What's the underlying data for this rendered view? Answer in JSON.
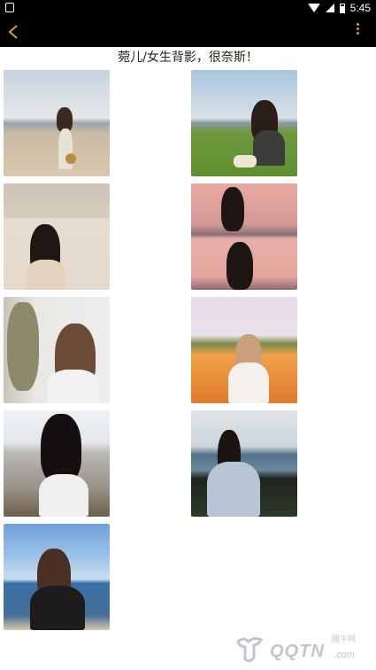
{
  "status_bar": {
    "time": "5:45",
    "icons": [
      "notification-icon",
      "wifi-icon",
      "signal-icon",
      "battery-icon"
    ]
  },
  "toolbar": {
    "back_icon": "chevron-left-icon",
    "more_icon": "more-vertical-icon",
    "accent_color": "#d4a017"
  },
  "page": {
    "title": "菀儿/女生背影，很奈斯！"
  },
  "photos": [
    {
      "label": "girl-with-hat-on-beach"
    },
    {
      "label": "girl-sitting-on-grass"
    },
    {
      "label": "girl-by-wall"
    },
    {
      "label": "girl-pink-sunset-profile"
    },
    {
      "label": "girl-by-palm-plant"
    },
    {
      "label": "girl-in-flower-field"
    },
    {
      "label": "girl-on-seaside-bench"
    },
    {
      "label": "girl-on-rocks-by-sea"
    },
    {
      "label": "girl-by-blue-sea"
    }
  ],
  "watermark": {
    "main": "QQTN",
    "suffix": ".com",
    "small": "腾牛网"
  }
}
